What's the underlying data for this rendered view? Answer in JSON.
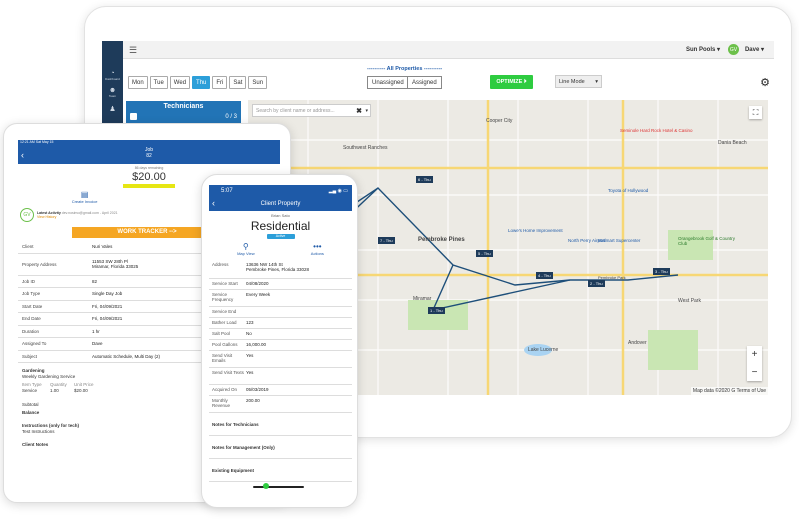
{
  "sidebar": {
    "items": [
      {
        "label": "Dashboard",
        "icon": "gauge-icon"
      },
      {
        "label": "Team",
        "icon": "team-icon"
      },
      {
        "label": "",
        "icon": "user-icon"
      }
    ]
  },
  "topbar": {
    "company": "Sun Pools ▾",
    "avatar": "GV",
    "user": "Dave ▾"
  },
  "days": [
    "Mon",
    "Tue",
    "Wed",
    "Thu",
    "Fri",
    "Sat",
    "Sun"
  ],
  "active_day": "Thu",
  "filters": {
    "title": "All Properties",
    "unassigned": "Unassigned",
    "assigned": "Assigned",
    "optimize": "OPTIMIZE ⏵",
    "line_mode": "Line Mode"
  },
  "technicians": {
    "title": "Technicians",
    "count": "0 / 3"
  },
  "map": {
    "search_placeholder": "Search by client name or address...",
    "footer": "Map data ©2020 G Terms of Use",
    "stops": [
      {
        "label": "6 - Thu"
      },
      {
        "label": "7 - Thu"
      },
      {
        "label": "5 - Thu"
      },
      {
        "label": "4 - Thu"
      },
      {
        "label": "2 - Thu"
      },
      {
        "label": "3 - Thu"
      },
      {
        "label": "1 - Thu"
      }
    ],
    "places": [
      "Pembroke Pines",
      "Miramar",
      "Lake Lucerne",
      "North Perry Airport",
      "Dania Beach",
      "Cooper City",
      "Southwest Ranches",
      "Seminole Hard Rock Hotel & Casino",
      "Lowe's Home Improvement",
      "Walmart Supercenter",
      "Orangebrook Golf & Country Club",
      "Toyota of Hollywood",
      "West Park",
      "Pembroke Gardens",
      "Andover",
      "Pembroke Park"
    ]
  },
  "phone_job": {
    "status": "12:21 AM  Sat May 15",
    "title": "Job",
    "number": "82",
    "due": "86 days remaining",
    "price": "$20.00",
    "actions": [
      "Create Invoice",
      "Send Quote"
    ],
    "gv": "GV",
    "activity": "Latest Activity",
    "activity_detail": "dev.nosimo@gmail.com - April 2021",
    "view_history": "View History",
    "work_tracker": "WORK TRACKER -->",
    "rows": [
      [
        "Client",
        "Nuri Vales"
      ],
      [
        "Property Address",
        "11553 SW 28th Pl\nMiramar, Florida 33025"
      ],
      [
        "Job ID",
        "82"
      ],
      [
        "Job Type",
        "Single Day Job"
      ],
      [
        "Start Date",
        "Fri, 04/09/2021"
      ],
      [
        "End Date",
        "Fri, 04/09/2021"
      ],
      [
        "Duration",
        "1 hr"
      ],
      [
        "Assigned To",
        "Dave"
      ],
      [
        "Subject",
        "Automatic Schedule, Multi Day (2)"
      ]
    ],
    "gardening": "Gardening",
    "gardening_sub": "Weekly Gardening Service",
    "item_headers": [
      "Item Type",
      "Quantity",
      "Unit Price"
    ],
    "item_values": [
      "Service",
      "1.00",
      "$20.00"
    ],
    "subtotal": "Subtotal",
    "balance": "Balance",
    "instructions": "Instructions (only for tech)",
    "instructions_val": "Test Instructions",
    "client_notes": "Client Notes"
  },
  "phone_prop": {
    "time": "5:07",
    "title": "Client Property",
    "name": "Brian Sato",
    "type": "Residential",
    "badge": "Active",
    "actions": [
      "Map View",
      "Actions"
    ],
    "rows": [
      [
        "Address",
        "13636 NW 14th St\nPembroke Pines, Florida 33028"
      ],
      [
        "Service Start",
        "04/08/2020"
      ],
      [
        "Service Frequency",
        "Every Week"
      ],
      [
        "Service End",
        ""
      ],
      [
        "Bather Load",
        "123"
      ],
      [
        "Salt Pool",
        "No"
      ],
      [
        "Pool Gallons",
        "16,000.00"
      ],
      [
        "Send Visit Emails",
        "Yes"
      ],
      [
        "Send Visit Texts",
        "Yes"
      ],
      [
        "Acquired On",
        "05/03/2019"
      ],
      [
        "Monthly Revenue",
        "200.00"
      ]
    ],
    "notes": [
      "Notes for Technicians",
      "Notes for Management (Only)",
      "Existing Equipment"
    ]
  }
}
